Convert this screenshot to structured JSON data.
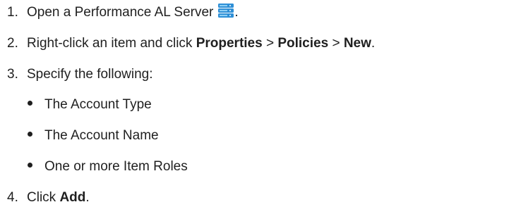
{
  "steps": [
    {
      "number": "1.",
      "text_before": "Open a Performance AL Server",
      "icon": "server-icon",
      "text_after": "."
    },
    {
      "number": "2.",
      "text_before": "Right-click an item and click ",
      "bold1": "Properties",
      "sep1": " > ",
      "bold2": "Policies",
      "sep2": " > ",
      "bold3": "New",
      "text_after": "."
    },
    {
      "number": "3.",
      "text": "Specify the following:"
    },
    {
      "number": "4.",
      "text_before": "Click ",
      "bold": "Add",
      "text_after": "."
    }
  ],
  "sub_items": [
    "The Account Type",
    "The Account Name",
    "One or more Item Roles"
  ],
  "colors": {
    "text": "#1f1f1f",
    "icon_blue": "#2e8fd6",
    "icon_light": "#8ed0f5"
  }
}
